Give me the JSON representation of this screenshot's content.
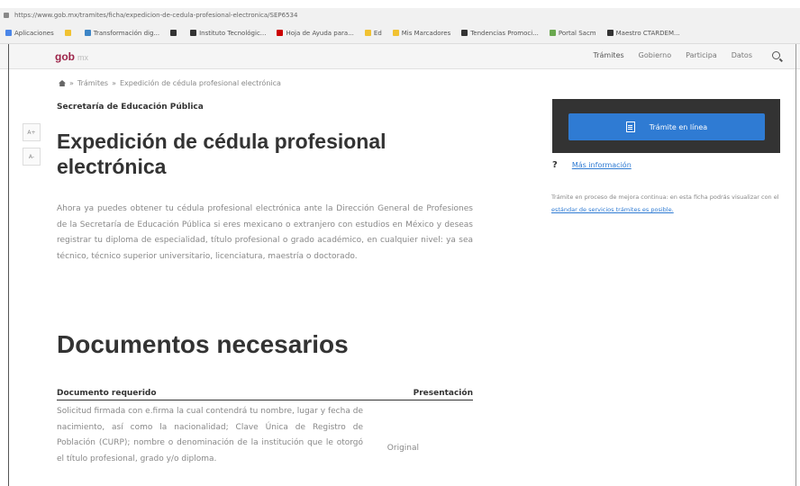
{
  "browser": {
    "url": "https://www.gob.mx/tramites/ficha/expedicion-de-cedula-profesional-electronica/SEP6534",
    "bookmarks": [
      {
        "label": "Aplicaciones",
        "color": "#4a86e8"
      },
      {
        "label": "",
        "color": "#f1c232"
      },
      {
        "label": "Transformación dig...",
        "color": "#3d85c6"
      },
      {
        "label": "",
        "color": "#333333"
      },
      {
        "label": "Instituto Tecnológic...",
        "color": "#333333"
      },
      {
        "label": "Hoja de Ayuda para...",
        "color": "#cc0000"
      },
      {
        "label": "Ed",
        "color": "#f1c232"
      },
      {
        "label": "Mis Marcadores",
        "color": "#f1c232"
      },
      {
        "label": "Tendencias Promoci...",
        "color": "#333333"
      },
      {
        "label": "Portal Sacm",
        "color": "#6aa84f"
      },
      {
        "label": "Maestro CTARDEM...",
        "color": "#333333"
      }
    ]
  },
  "header": {
    "logo": "gob",
    "logo_suffix": "mx",
    "nav": [
      "Trámites",
      "Gobierno",
      "Participa",
      "Datos"
    ]
  },
  "breadcrumb": {
    "items": [
      "Trámites",
      "Expedición de cédula profesional electrónica"
    ],
    "separator": "»"
  },
  "agency": "Secretaría de Educación Pública",
  "side_buttons": [
    "A+",
    "A-"
  ],
  "title": "Expedición de cédula profesional electrónica",
  "intro": "Ahora ya puedes obtener tu cédula profesional electrónica ante la Dirección General de Profesiones de la Secretaría de Educación Pública si eres mexicano o extranjero con estudios en México y deseas registrar tu diploma de especialidad, título profesional o grado académico, en cualquier nivel: ya sea técnico, técnico superior universitario, licenciatura, maestría o doctorado.",
  "section_title": "Documentos necesarios",
  "table": {
    "headers": [
      "Documento requerido",
      "Presentación"
    ],
    "rows": [
      {
        "document": "Solicitud firmada con e.firma la cual contendrá tu nombre, lugar y fecha de nacimiento, así como la nacionalidad; Clave Única de Registro de Población (CURP); nombre o denominación de la institución que le otorgó el título profesional, grado y/o diploma.",
        "presentation": "Original"
      }
    ]
  },
  "panel": {
    "button_label": "Trámite en línea",
    "more_info": "Más información",
    "note_text": "Trámite en proceso de mejora continua: en esta ficha podrás visualizar con el ",
    "note_link": "estándar de servicios trámites es posible."
  },
  "colors": {
    "brand": "#9d2449",
    "panel_bg": "#333333",
    "button": "#2f7bd3",
    "link": "#2f7bd3"
  }
}
